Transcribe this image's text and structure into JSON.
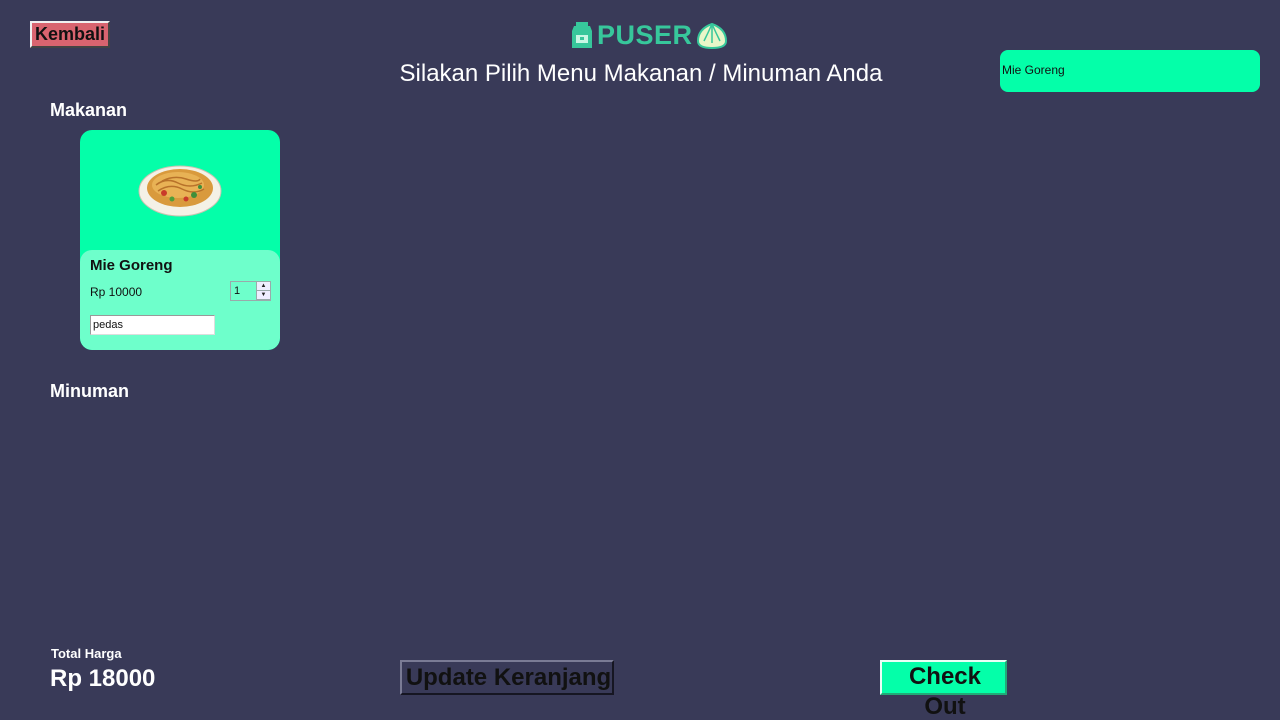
{
  "header": {
    "back_label": "Kembali",
    "logo_text": "PUSER",
    "title": "Silakan Pilih Menu Makanan / Minuman Anda"
  },
  "cart": {
    "items": [
      "Mie Goreng"
    ]
  },
  "sections": {
    "food": {
      "heading": "Makanan",
      "items": [
        {
          "name": "Mie Goreng",
          "price": "Rp 10000",
          "quantity": "1",
          "note": "pedas",
          "image": "fried-noodles-plate-image"
        }
      ]
    },
    "drinks": {
      "heading": "Minuman",
      "items": []
    }
  },
  "footer": {
    "total_label": "Total Harga",
    "total_value": "Rp 18000",
    "update_label": "Update Keranjang",
    "checkout_label": "Check Out"
  },
  "icons": {
    "logo_left": "milk-carton-icon",
    "logo_right": "dumpling-icon",
    "qty_up": "chevron-up-icon",
    "qty_down": "chevron-down-icon"
  },
  "colors": {
    "background": "#393a58",
    "accent": "#04ffa9",
    "card_body": "#6effcb",
    "back_button": "#d9646f",
    "logo": "#37c79b"
  }
}
